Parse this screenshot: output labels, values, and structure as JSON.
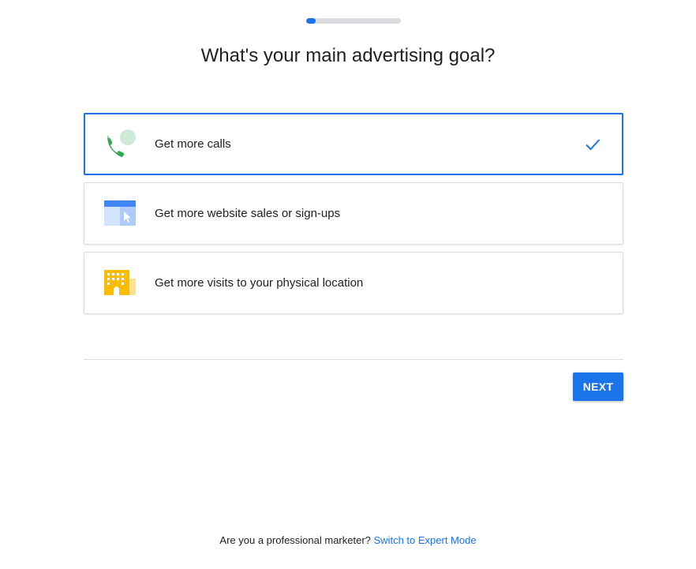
{
  "progress": {
    "fraction": 0.1,
    "fill_color": "#1a73e8"
  },
  "title": "What's your main advertising goal?",
  "options": [
    {
      "label": "Get more calls",
      "icon": "phone-call-icon",
      "selected": true
    },
    {
      "label": "Get more website sales or sign-ups",
      "icon": "browser-window-icon",
      "selected": false
    },
    {
      "label": "Get more visits to your physical location",
      "icon": "building-icon",
      "selected": false
    }
  ],
  "next_button": {
    "label": "NEXT"
  },
  "footer": {
    "text": "Are you a professional marketer?",
    "link_text": "Switch to Expert Mode"
  },
  "colors": {
    "accent": "#1a73e8",
    "phone_green": "#34a853",
    "building_yellow": "#fbbc04"
  }
}
